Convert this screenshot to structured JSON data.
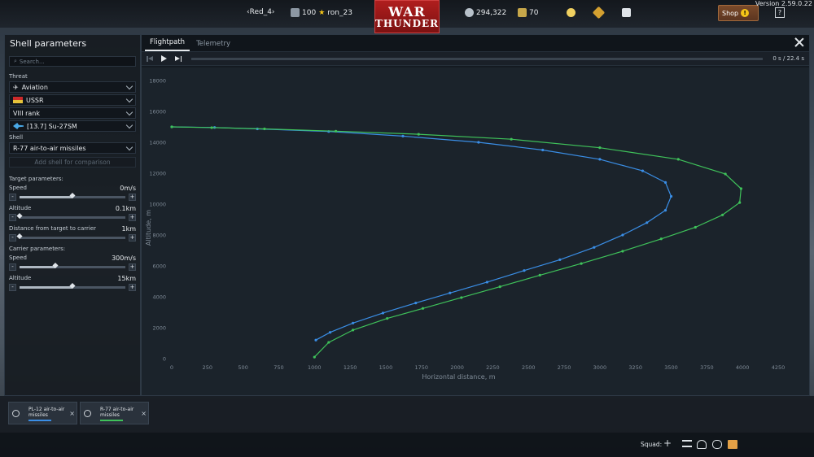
{
  "topbar": {
    "battle_name": "‹Red_4›",
    "level": "100",
    "username": "ron_23",
    "silver": "294,322",
    "gold": "70",
    "shop_label": "Shop",
    "shop_badge": "!",
    "help_label": "?",
    "version": "Version 2.59.0.22",
    "logo_line1": "WAR",
    "logo_line2": "THUNDER"
  },
  "sidebar": {
    "title": "Shell parameters",
    "search_placeholder": "Search...",
    "threat_label": "Threat",
    "threat_type": "Aviation",
    "nation": "USSR",
    "rank": "VIII rank",
    "vehicle": "[13.7] Su-27SM",
    "shell_label": "Shell",
    "shell": "R-77 air-to-air missiles",
    "compare_label": "Add shell for comparison",
    "target_section": "Target parameters:",
    "target_speed_label": "Speed",
    "target_speed_value": "0m/s",
    "target_speed_level": 0.5,
    "target_altitude_label": "Altitude",
    "target_altitude_value": "0.1km",
    "target_altitude_level": 0.0,
    "distance_label": "Distance from target to carrier",
    "distance_value": "1km",
    "distance_level": 0.0,
    "carrier_section": "Carrier parameters:",
    "carrier_speed_label": "Speed",
    "carrier_speed_value": "300m/s",
    "carrier_speed_level": 0.34,
    "carrier_altitude_label": "Altitude",
    "carrier_altitude_value": "15km",
    "carrier_altitude_level": 0.5
  },
  "main": {
    "tabs": [
      {
        "label": "Flightpath",
        "active": true
      },
      {
        "label": "Telemetry",
        "active": false
      }
    ],
    "time_current": "0 s",
    "time_sep": "/",
    "time_total": "22.4 s"
  },
  "chart_data": {
    "type": "line",
    "xlabel": "Horizontal distance, m",
    "ylabel": "Altitude, m",
    "xlim": [
      0,
      4250
    ],
    "ylim": [
      0,
      18000
    ],
    "xticks": [
      0,
      250,
      500,
      750,
      1000,
      1250,
      1500,
      1750,
      2000,
      2250,
      2500,
      2750,
      3000,
      3250,
      3500,
      3750,
      4000,
      4250
    ],
    "yticks": [
      0,
      2000,
      4000,
      6000,
      8000,
      10000,
      12000,
      14000,
      16000,
      18000
    ],
    "grid": false,
    "series": [
      {
        "name": "PL-12 air-to-air missiles",
        "color": "#3a8ee6",
        "points": [
          [
            0,
            15000
          ],
          [
            300,
            14960
          ],
          [
            600,
            14870
          ],
          [
            1100,
            14700
          ],
          [
            1620,
            14400
          ],
          [
            2150,
            14000
          ],
          [
            2600,
            13500
          ],
          [
            3000,
            12900
          ],
          [
            3300,
            12150
          ],
          [
            3460,
            11400
          ],
          [
            3500,
            10500
          ],
          [
            3460,
            9600
          ],
          [
            3330,
            8800
          ],
          [
            3160,
            8000
          ],
          [
            2960,
            7200
          ],
          [
            2720,
            6400
          ],
          [
            2470,
            5700
          ],
          [
            2210,
            4950
          ],
          [
            1950,
            4250
          ],
          [
            1710,
            3600
          ],
          [
            1480,
            2950
          ],
          [
            1270,
            2300
          ],
          [
            1110,
            1700
          ],
          [
            1010,
            1200
          ]
        ]
      },
      {
        "name": "R-77 air-to-air missiles",
        "color": "#3fc25a",
        "points": [
          [
            0,
            15000
          ],
          [
            280,
            14950
          ],
          [
            650,
            14870
          ],
          [
            1150,
            14720
          ],
          [
            1730,
            14520
          ],
          [
            2380,
            14200
          ],
          [
            3000,
            13650
          ],
          [
            3550,
            12900
          ],
          [
            3880,
            11950
          ],
          [
            3990,
            11000
          ],
          [
            3980,
            10100
          ],
          [
            3860,
            9300
          ],
          [
            3670,
            8500
          ],
          [
            3430,
            7750
          ],
          [
            3160,
            6950
          ],
          [
            2870,
            6150
          ],
          [
            2580,
            5400
          ],
          [
            2300,
            4650
          ],
          [
            2030,
            3950
          ],
          [
            1760,
            3250
          ],
          [
            1510,
            2600
          ],
          [
            1270,
            1850
          ],
          [
            1100,
            1050
          ],
          [
            1000,
            100
          ]
        ]
      }
    ]
  },
  "compare_cards": [
    {
      "name": "PL-12 air-to-air missiles",
      "color": "#3a8ee6",
      "close": "×"
    },
    {
      "name": "R-77 air-to-air missiles",
      "color": "#3fc25a",
      "close": "×"
    }
  ],
  "footer": {
    "squad_label": "Squad:"
  }
}
